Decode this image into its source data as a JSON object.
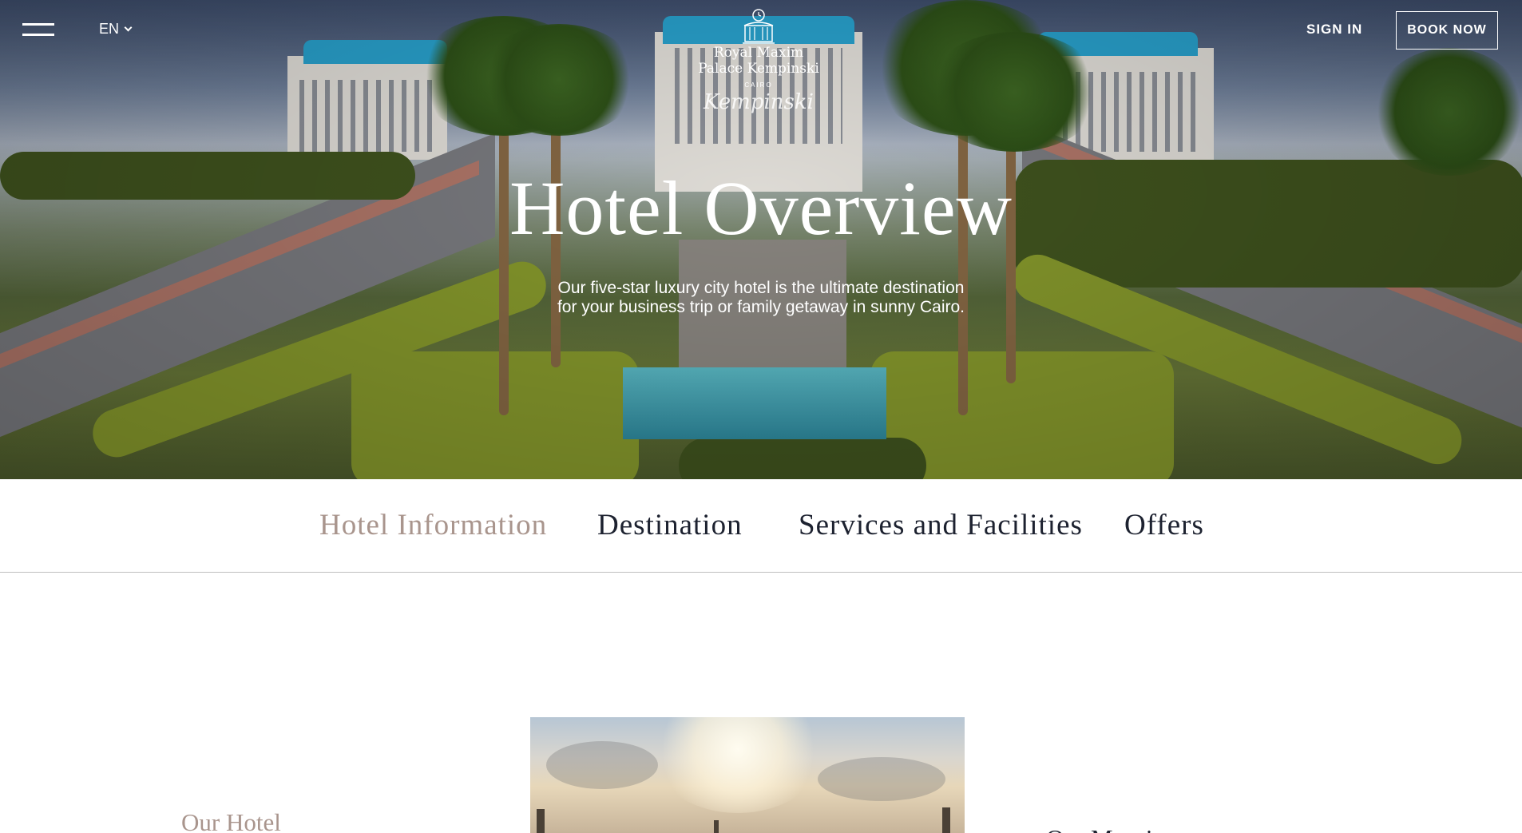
{
  "header": {
    "menu_icon": "hamburger-icon",
    "language": "EN",
    "language_icon": "chevron-down-icon",
    "sign_in": "SIGN IN",
    "book_now": "BOOK NOW"
  },
  "logo": {
    "name_line1": "Royal Maxim",
    "name_line2": "Palace Kempinski",
    "city": "CAIRO",
    "script": "Kempinski",
    "emblem_icon": "palace-emblem-icon"
  },
  "hero": {
    "title": "Hotel Overview",
    "subtitle_line1": "Our five-star luxury city hotel is the ultimate destination",
    "subtitle_line2": "for your business trip or family getaway in sunny Cairo."
  },
  "tabs": [
    {
      "label": "Hotel Information",
      "active": true
    },
    {
      "label": "Destination",
      "active": false
    },
    {
      "label": "Services and Facilities",
      "active": false
    },
    {
      "label": "Offers",
      "active": false
    }
  ],
  "content": {
    "left_heading": "Our Hotel",
    "right_heading": "Our Mosaic"
  },
  "colors": {
    "active_tab": "#a9958d",
    "text_dark": "#1d2230",
    "white": "#ffffff"
  }
}
